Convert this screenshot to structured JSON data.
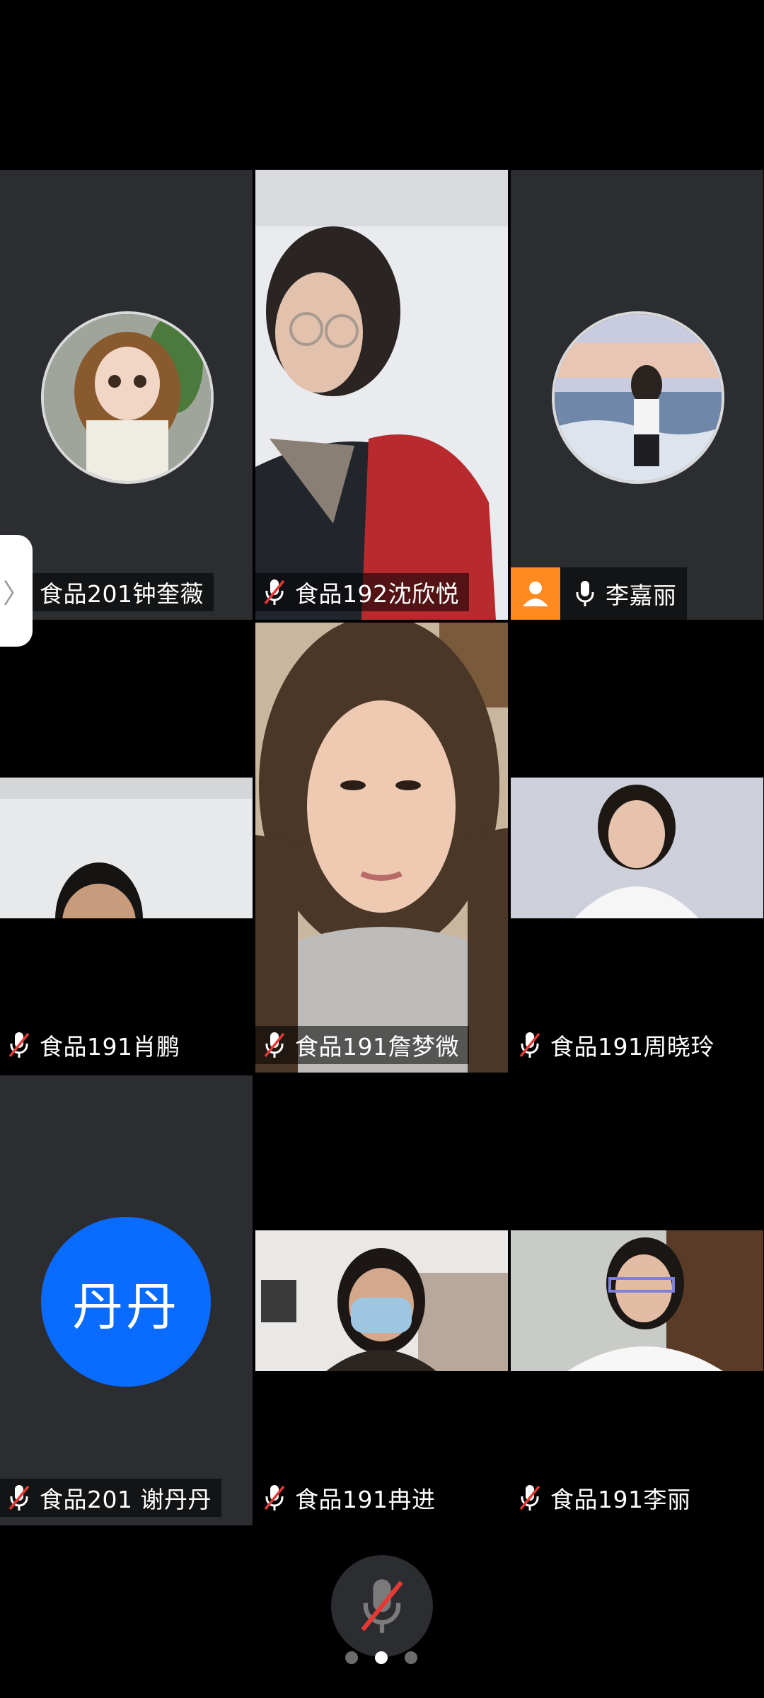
{
  "participants": [
    {
      "name": "食品201钟奎薇",
      "mic": "muted",
      "tile": "avatar"
    },
    {
      "name": "食品192沈欣悦",
      "mic": "muted",
      "tile": "video"
    },
    {
      "name": "李嘉丽",
      "mic": "on",
      "tile": "avatar",
      "host": true
    },
    {
      "name": "食品191肖鹏",
      "mic": "muted",
      "tile": "video"
    },
    {
      "name": "食品191詹梦微",
      "mic": "muted",
      "tile": "video"
    },
    {
      "name": "食品191周晓玲",
      "mic": "muted",
      "tile": "video"
    },
    {
      "name": "食品201 谢丹丹",
      "mic": "muted",
      "tile": "letter",
      "avatar_text": "丹丹"
    },
    {
      "name": "食品191冉进",
      "mic": "muted",
      "tile": "video"
    },
    {
      "name": "食品191李丽",
      "mic": "muted",
      "tile": "video"
    }
  ],
  "side_handle": {
    "icon": "chevron-right-icon",
    "glyph": "〉"
  },
  "controls": {
    "mic_state": "muted",
    "icon": "mic-muted-icon"
  },
  "pagination": {
    "total": 3,
    "current": 2
  },
  "colors": {
    "accent_blue": "#0a6cff",
    "host_orange": "#ff8a1f",
    "mute_red": "#e53935",
    "tile_bg": "#2b2d30"
  }
}
